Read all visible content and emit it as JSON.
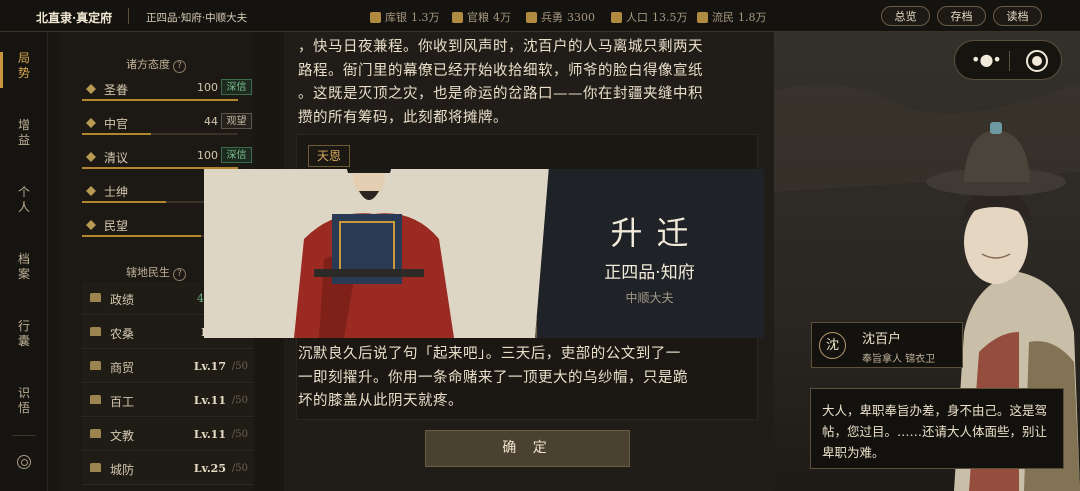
{
  "topbar": {
    "location": "北直隶·真定府",
    "rank": "正四品·知府·中顺大夫",
    "resources": [
      {
        "label": "库银",
        "value": "1.3万",
        "icon": "silver-icon"
      },
      {
        "label": "官粮",
        "value": "4万",
        "icon": "grain-icon"
      },
      {
        "label": "兵勇",
        "value": "3300",
        "icon": "soldier-icon"
      },
      {
        "label": "人口",
        "value": "13.5万",
        "icon": "population-icon"
      },
      {
        "label": "流民",
        "value": "1.8万",
        "icon": "refugee-icon"
      }
    ],
    "buttons": {
      "overview": "总览",
      "save": "存档",
      "load": "读档"
    }
  },
  "nav": {
    "items": [
      "局势",
      "增益",
      "个人",
      "档案",
      "行囊",
      "识悟"
    ],
    "active": "局势"
  },
  "attitudes": {
    "title": "诸方态度",
    "help": "?",
    "items": [
      {
        "name": "圣眷",
        "value": "100",
        "tag": "深信",
        "level": 1.0
      },
      {
        "name": "中官",
        "value": "44",
        "tag": "观望",
        "level": 0.44
      },
      {
        "name": "清议",
        "value": "100",
        "tag": "深信",
        "level": 1.0
      },
      {
        "name": "士绅",
        "value": "54",
        "tag": "",
        "level": 0.54
      },
      {
        "name": "民望",
        "value": "76",
        "tag": "",
        "level": 0.76
      }
    ]
  },
  "domain": {
    "title": "辖地民生",
    "help": "?",
    "items": [
      {
        "name": "政绩",
        "level": "462",
        "max": ""
      },
      {
        "name": "农桑",
        "level": "Lv.",
        "max": ""
      },
      {
        "name": "商贸",
        "level": "Lv.17",
        "max": "/50"
      },
      {
        "name": "百工",
        "level": "Lv.11",
        "max": "/50"
      },
      {
        "name": "文教",
        "level": "Lv.11",
        "max": "/50"
      },
      {
        "name": "城防",
        "level": "Lv.25",
        "max": "/50"
      }
    ]
  },
  "story": {
    "top_lines": [
      "，快马日夜兼程。你收到风声时，沈百户的人马离城只剩两天",
      "路程。衙门里的幕僚已经开始收拾细软，师爷的脸白得像宣纸",
      "。这既是灭顶之灾，也是命运的岔路口——你在封疆夹缝中积",
      "攒的所有筹码，此刻都将摊牌。"
    ],
    "tag": "天恩",
    "bottom_lines": [
      "沉默良久后说了句「起来吧」。三天后，吏部的公文到了一",
      "一即刻擢升。你用一条命赌来了一顶更大的乌纱帽，只是跪",
      "坏的膝盖从此阴天就疼。"
    ],
    "confirm": "确 定"
  },
  "banner": {
    "title": "升迁",
    "rank": "正四品·知府",
    "sub": "中顺大夫"
  },
  "npc": {
    "seal": "沈",
    "name": "沈百户",
    "sub": "奉旨拿人  锦衣卫",
    "dialog": "大人，卑职奉旨办差，身不由己。这是驾帖，您过目。……还请大人体面些，别让卑职为难。"
  }
}
